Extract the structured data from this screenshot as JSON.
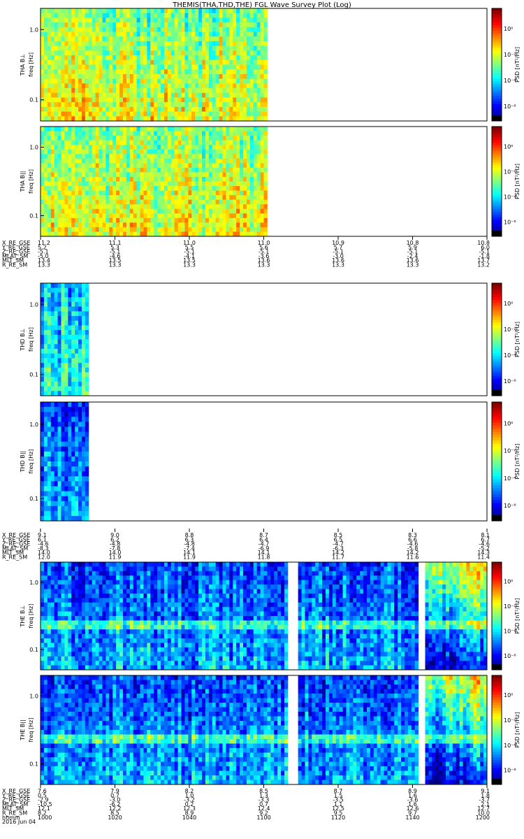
{
  "title": "THEMIS(THA,THD,THE) FGL Wave Survey Plot (Log)",
  "colorbar_label": "PSD [nT²/Hz]",
  "colorbar_ticks": [
    "10⁰",
    "10⁻²",
    "10⁻⁴",
    "10⁻⁶"
  ],
  "freq_ticks": [
    "1.0",
    "0.1"
  ],
  "date_label": "2016 Jun 04",
  "chart_data": [
    {
      "type": "heatmap",
      "probe": "THA",
      "panels": [
        {
          "name": "THA B⊥",
          "ylabel": "freq [Hz]",
          "yscale": "log",
          "ylim": [
            0.05,
            2.0
          ],
          "colorbar": "PSD [nT²/Hz]",
          "zscale": "log",
          "zlim": [
            1e-06,
            10.0
          ],
          "data_end_fraction": 0.51,
          "level": "high"
        },
        {
          "name": "THA B||",
          "ylabel": "freq [Hz]",
          "yscale": "log",
          "ylim": [
            0.05,
            2.0
          ],
          "colorbar": "PSD [nT²/Hz]",
          "zscale": "log",
          "zlim": [
            1e-06,
            10.0
          ],
          "data_end_fraction": 0.51,
          "level": "high"
        }
      ],
      "orbit_rows": [
        {
          "name": "X_RE_GSE",
          "values": [
            "11.2",
            "11.1",
            "11.0",
            "11.0",
            "10.9",
            "10.8",
            "10.8"
          ]
        },
        {
          "name": "Y_RE_GSE",
          "values": [
            "5.2",
            "5.3",
            "5.5",
            "5.6",
            "5.7",
            "5.9",
            "6.0"
          ]
        },
        {
          "name": "Z_RE_GSE",
          "values": [
            "-5.1",
            "-5.1",
            "-5.1",
            "-5.1",
            "-5.1",
            "-5.1",
            "-5.1"
          ]
        },
        {
          "name": "MLAT_SM",
          "values": [
            "-5.0",
            "-4.6",
            "-4.1",
            "-3.6",
            "-3.0",
            "-2.4",
            "-1.8"
          ]
        },
        {
          "name": "MLT_SM",
          "values": [
            "13.4",
            "13.5",
            "13.5",
            "13.6",
            "13.6",
            "13.6",
            "13.7"
          ]
        },
        {
          "name": "R_RE_SM",
          "values": [
            "13.3",
            "13.3",
            "13.3",
            "13.3",
            "13.3",
            "13.3",
            "13.2"
          ]
        }
      ]
    },
    {
      "type": "heatmap",
      "probe": "THD",
      "panels": [
        {
          "name": "THD B⊥",
          "ylabel": "freq [Hz]",
          "yscale": "log",
          "ylim": [
            0.05,
            2.0
          ],
          "colorbar": "PSD [nT²/Hz]",
          "zscale": "log",
          "zlim": [
            1e-06,
            10.0
          ],
          "data_end_fraction": 0.11,
          "level": "mid"
        },
        {
          "name": "THD B||",
          "ylabel": "freq [Hz]",
          "yscale": "log",
          "ylim": [
            0.05,
            2.0
          ],
          "colorbar": "PSD [nT²/Hz]",
          "zscale": "log",
          "zlim": [
            1e-06,
            10.0
          ],
          "data_end_fraction": 0.11,
          "level": "low"
        }
      ],
      "orbit_rows": [
        {
          "name": "X_RE_GSE",
          "values": [
            "9.1",
            "9.0",
            "8.8",
            "8.7",
            "8.5",
            "8.3",
            "8.1"
          ]
        },
        {
          "name": "Y_RE_GSE",
          "values": [
            "6.1",
            "6.2",
            "6.3",
            "6.4",
            "6.5",
            "6.6",
            "6.7"
          ]
        },
        {
          "name": "Z_RE_GSE",
          "values": [
            "-4.6",
            "-4.8",
            "-4.8",
            "-4.7",
            "-4.7",
            "-4.6",
            "-4.6"
          ]
        },
        {
          "name": "MLAT_SM",
          "values": [
            "-8.3",
            "-7.8",
            "-7.4",
            "-6.9",
            "-6.3",
            "-5.8",
            "-5.2"
          ]
        },
        {
          "name": "MLT_SM",
          "values": [
            "14.0",
            "14.0",
            "14.1",
            "14.1",
            "14.2",
            "14.2",
            "14.3"
          ]
        },
        {
          "name": "R_RE_SM",
          "values": [
            "12.0",
            "11.9",
            "11.9",
            "11.8",
            "11.7",
            "11.6",
            "11.4"
          ]
        }
      ]
    },
    {
      "type": "heatmap",
      "probe": "THE",
      "panels": [
        {
          "name": "THE B⊥",
          "ylabel": "freq [Hz]",
          "yscale": "log",
          "ylim": [
            0.05,
            2.0
          ],
          "colorbar": "PSD [nT²/Hz]",
          "zscale": "log",
          "zlim": [
            1e-06,
            10.0
          ],
          "data_end_fraction": 1.0,
          "level": "low"
        },
        {
          "name": "THE B||",
          "ylabel": "freq [Hz]",
          "yscale": "log",
          "ylim": [
            0.05,
            2.0
          ],
          "colorbar": "PSD [nT²/Hz]",
          "zscale": "log",
          "zlim": [
            1e-06,
            10.0
          ],
          "data_end_fraction": 1.0,
          "level": "low"
        }
      ],
      "orbit_rows": [
        {
          "name": "X_RE_GSE",
          "values": [
            "7.6",
            "7.9",
            "8.2",
            "8.5",
            "8.7",
            "8.9",
            "9.1"
          ]
        },
        {
          "name": "Y_RE_GSE",
          "values": [
            "0.5",
            "0.7",
            "1.0",
            "1.3",
            "1.5",
            "1.6",
            "1.8"
          ]
        },
        {
          "name": "Z_RE_GSE",
          "values": [
            "-2.9",
            "-3.0",
            "-3.2",
            "-3.3",
            "-3.5",
            "-3.6",
            "-3.7"
          ]
        },
        {
          "name": "MLAT_SM",
          "values": [
            "-10.5",
            "-6.2",
            "0.2",
            "0.7",
            "1.1",
            "1.6",
            "2.1"
          ]
        },
        {
          "name": "MLT_SM",
          "values": [
            "12.1",
            "12.2",
            "12.3",
            "12.4",
            "12.5",
            "12.6",
            "12.7"
          ]
        },
        {
          "name": "R_RE_SM",
          "values": [
            "8.2",
            "8.5",
            "8.9",
            "9.2",
            "9.5",
            "9.7",
            "10.0"
          ]
        },
        {
          "name": "hhmm",
          "values": [
            "1000",
            "1020",
            "1040",
            "1100",
            "1120",
            "1140",
            "1200"
          ]
        }
      ]
    }
  ]
}
